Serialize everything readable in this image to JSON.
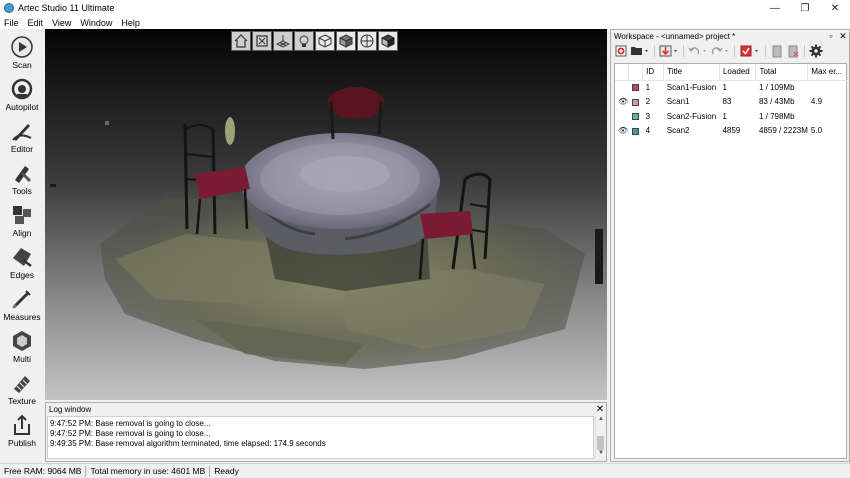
{
  "window": {
    "title": "Artec Studio 11 Ultimate",
    "controls": [
      "—",
      "❐",
      "✕"
    ]
  },
  "menu": [
    "File",
    "Edit",
    "View",
    "Window",
    "Help"
  ],
  "tools": [
    {
      "label": "Scan",
      "icon": "scan-icon"
    },
    {
      "label": "Autopilot",
      "icon": "autopilot-icon"
    },
    {
      "label": "Editor",
      "icon": "editor-icon"
    },
    {
      "label": "Tools",
      "icon": "tools-icon"
    },
    {
      "label": "Align",
      "icon": "align-icon"
    },
    {
      "label": "Edges",
      "icon": "edges-icon"
    },
    {
      "label": "Measures",
      "icon": "measures-icon"
    },
    {
      "label": "Multi",
      "icon": "multi-icon"
    },
    {
      "label": "Texture",
      "icon": "texture-icon"
    },
    {
      "label": "Publish",
      "icon": "publish-icon"
    }
  ],
  "viewport_toolbar": [
    "home-view-icon",
    "fit-view-icon",
    "grid-icon",
    "light-icon",
    "wireframe-icon",
    "solid-icon",
    "sphere-view-icon",
    "textured-cube-icon"
  ],
  "log": {
    "title": "Log window",
    "close": "✕",
    "lines": [
      "9:47:52 PM: Base removal is going to close...",
      "9:47:52 PM: Base removal is going to close...",
      "9:49:35 PM: Base removal algorithm terminated, time elapsed: 174.9 seconds"
    ]
  },
  "status": {
    "free_ram": "Free RAM: 9064 MB",
    "total_memory": "Total memory in use: 4601 MB",
    "state": "Ready"
  },
  "workspace": {
    "title": "Workspace - <unnamed> project *",
    "header_buttons": [
      "▫",
      "✕"
    ],
    "columns": [
      "",
      "",
      "ID",
      "Title",
      "Loaded",
      "Total",
      "Max er..."
    ],
    "rows": [
      {
        "visible": "",
        "color": "#b9475e",
        "id": "1",
        "title": "Scan1-Fusion",
        "loaded": "1",
        "total": "1 / 109Mb",
        "max_err": ""
      },
      {
        "visible": "👁",
        "color": "#d49a9e",
        "id": "2",
        "title": "Scan1",
        "loaded": "83",
        "total": "83 / 43Mb",
        "max_err": "4.9"
      },
      {
        "visible": "",
        "color": "#56c07e",
        "id": "3",
        "title": "Scan2-Fusion",
        "loaded": "1",
        "total": "1 / 798Mb",
        "max_err": ""
      },
      {
        "visible": "👁",
        "color": "#3f9c9a",
        "id": "4",
        "title": "Scan2",
        "loaded": "4859",
        "total": "4859 / 2223M",
        "max_err": "5.0"
      }
    ]
  }
}
